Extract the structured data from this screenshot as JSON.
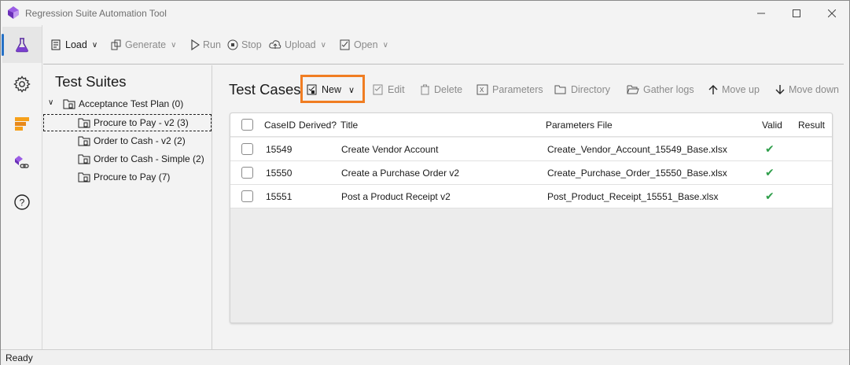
{
  "window": {
    "title": "Regression Suite Automation Tool"
  },
  "toolbar": {
    "load": "Load",
    "generate": "Generate",
    "run": "Run",
    "stop": "Stop",
    "upload": "Upload",
    "open": "Open"
  },
  "suites": {
    "title": "Test Suites",
    "plan": "Acceptance Test Plan (0)",
    "items": [
      "Procure to Pay - v2 (3)",
      "Order to Cash - v2 (2)",
      "Order to Cash - Simple (2)",
      "Procure to Pay (7)"
    ]
  },
  "cases": {
    "title": "Test Cases",
    "buttons": {
      "new": "New",
      "edit": "Edit",
      "delete": "Delete",
      "parameters": "Parameters",
      "directory": "Directory",
      "gather_logs": "Gather logs",
      "move_up": "Move up",
      "move_down": "Move down"
    },
    "columns": {
      "case_id": "CaseID",
      "derived": "Derived?",
      "title": "Title",
      "parameters_file": "Parameters File",
      "valid": "Valid",
      "result": "Result"
    },
    "rows": [
      {
        "case_id": "15549",
        "title": "Create Vendor Account",
        "parameters_file": "Create_Vendor_Account_15549_Base.xlsx",
        "valid": true
      },
      {
        "case_id": "15550",
        "title": "Create a Purchase Order v2",
        "parameters_file": "Create_Purchase_Order_15550_Base.xlsx",
        "valid": true
      },
      {
        "case_id": "15551",
        "title": "Post a Product Receipt v2",
        "parameters_file": "Post_Product_Receipt_15551_Base.xlsx",
        "valid": true
      }
    ]
  },
  "status": {
    "text": "Ready"
  },
  "colors": {
    "highlight": "#f07d22",
    "valid_check": "#2e9e4a",
    "accent": "#2470c6"
  }
}
